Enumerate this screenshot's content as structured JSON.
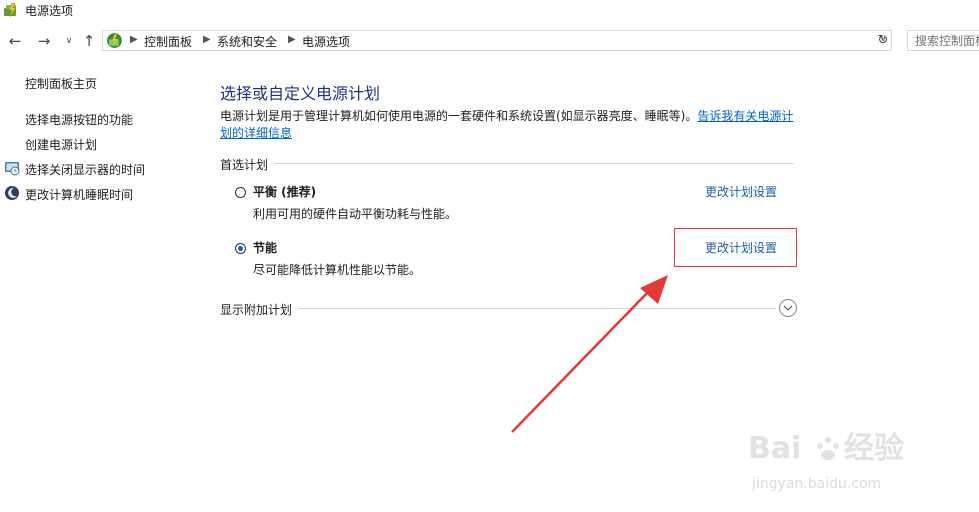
{
  "window": {
    "title": "电源选项"
  },
  "nav": {
    "back_icon": "arrow-left-icon",
    "forward_icon": "arrow-right-icon",
    "recent_icon": "chevron-down-icon",
    "up_icon": "arrow-up-icon",
    "breadcrumb": [
      "控制面板",
      "系统和安全",
      "电源选项"
    ],
    "search_placeholder": "搜索控制面板"
  },
  "sidebar": {
    "home": "控制面板主页",
    "links": [
      "选择电源按钮的功能",
      "创建电源计划",
      "选择关闭显示器的时间",
      "更改计算机睡眠时间"
    ]
  },
  "main": {
    "title": "选择或自定义电源计划",
    "description": "电源计划是用于管理计算机如何使用电源的一套硬件和系统设置(如显示器亮度、睡眠等)。",
    "help_link": "告诉我有关电源计划的详细信息",
    "preferred_label": "首选计划",
    "plans": [
      {
        "name": "平衡 (推荐)",
        "description": "利用可用的硬件自动平衡功耗与性能。",
        "link": "更改计划设置",
        "selected": false
      },
      {
        "name": "节能",
        "description": "尽可能降低计算机性能以节能。",
        "link": "更改计划设置",
        "selected": true
      }
    ],
    "additional_label": "显示附加计划"
  },
  "annotation": {
    "color": "#e53935"
  },
  "watermark": {
    "brand": "Baidu经验",
    "url": "jingyan.baidu.com"
  }
}
